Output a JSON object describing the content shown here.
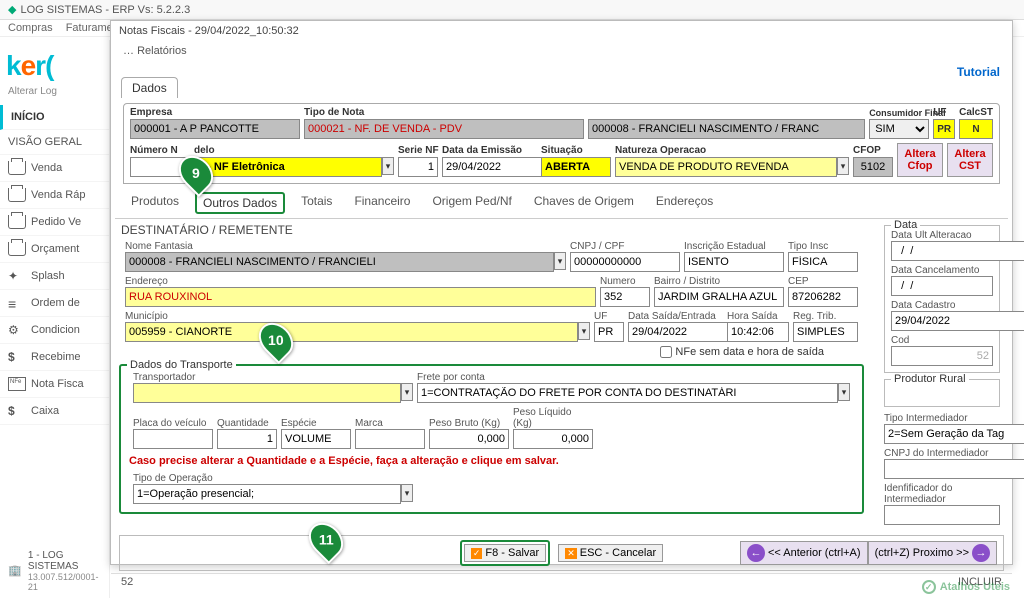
{
  "window": {
    "title": "LOG SISTEMAS - ERP Vs: 5.2.2.3"
  },
  "topmenu": {
    "compras": "Compras",
    "faturamento": "Faturamento"
  },
  "logo": {
    "k": "k",
    "e": "e",
    "r": "r",
    "alterar": "Alterar Log"
  },
  "nav": {
    "inicio": "INÍCIO",
    "visao": "VISÃO GERAL",
    "venda": "Venda",
    "vendarap": "Venda Ráp",
    "pedido": "Pedido Ve",
    "orcamento": "Orçament",
    "splash": "Splash",
    "ordem": "Ordem de",
    "condicio": "Condicion",
    "recebim": "Recebime",
    "notafis": "Nota Fisca",
    "caixa": "Caixa"
  },
  "dialog": {
    "title": "Notas Fiscais - 29/04/2022_10:50:32",
    "relatorios": "Relatórios",
    "tutorial": "Tutorial",
    "dados": "Dados"
  },
  "hdrf": {
    "empresa_lbl": "Empresa",
    "empresa_val": "000001 - A P PANCOTTE",
    "tiponota_lbl": "Tipo de Nota",
    "tiponota_val": "000021 - NF. DE VENDA - PDV",
    "cliente_val": "000008 - FRANCIELI NASCIMENTO / FRANC",
    "consfinal_lbl": "Consumidor Final",
    "consfinal_val": "SIM",
    "uf_lbl": "UF",
    "uf_val": "PR",
    "calcst_lbl": "CalcST",
    "calcst_val": "N",
    "numnf_lbl": "Número N",
    "modelo_lbl": "delo",
    "modelo_val": "5 - NF Eletrônica",
    "serie_lbl": "Serie NF",
    "serie_val": "1",
    "dataemi_lbl": "Data da Emissão",
    "dataemi_val": "29/04/2022",
    "situacao_lbl": "Situação",
    "situacao_val": "ABERTA",
    "natop_lbl": "Natureza Operacao",
    "natop_val": "VENDA DE PRODUTO REVENDA",
    "cfop_lbl": "CFOP",
    "cfop_val": "5102",
    "altera_cfop": "Altera Cfop",
    "altera_cst": "Altera CST"
  },
  "subtabs": {
    "produtos": "Produtos",
    "outros": "Outros Dados",
    "totais": "Totais",
    "financeiro": "Financeiro",
    "origem": "Origem Ped/Nf",
    "chaves": "Chaves de Origem",
    "enderecos": "Endereços"
  },
  "dest": {
    "title": "DESTINATÁRIO / REMETENTE",
    "nomefant_lbl": "Nome Fantasia",
    "nomefant_val": "000008 - FRANCIELI NASCIMENTO / FRANCIELI",
    "cnpj_lbl": "CNPJ / CPF",
    "cnpj_val": "00000000000",
    "insc_lbl": "Inscrição Estadual",
    "insc_val": "ISENTO",
    "tipoinsc_lbl": "Tipo Insc",
    "tipoinsc_val": "FÍSICA",
    "endereco_lbl": "Endereço",
    "endereco_val": "RUA ROUXINOL",
    "numero_lbl": "Numero",
    "numero_val": "352",
    "bairro_lbl": "Bairro / Distrito",
    "bairro_val": "JARDIM GRALHA AZUL",
    "cep_lbl": "CEP",
    "cep_val": "87206282",
    "municipio_lbl": "Município",
    "municipio_val": "005959 - CIANORTE",
    "uf_lbl": "UF",
    "uf_val": "PR",
    "datasaida_lbl": "Data Saída/Entrada",
    "datasaida_val": "29/04/2022",
    "horasaida_lbl": "Hora Saída",
    "horasaida_val": "10:42:06",
    "regtrib_lbl": "Reg. Trib.",
    "regtrib_val": "SIMPLES",
    "nfe_chk": "NFe sem data e hora de saída"
  },
  "datagroup": {
    "title": "Data",
    "ultalt_lbl": "Data Ult Alteracao",
    "ultalt_val": "  /  /",
    "cancel_lbl": "Data Cancelamento",
    "cancel_val": "  /  /",
    "cadastro_lbl": "Data Cadastro",
    "cadastro_val": "29/04/2022",
    "cod_lbl": "Cod",
    "cod_val": "52"
  },
  "transp": {
    "title": "Dados do Transporte",
    "transp_lbl": "Transportador",
    "frete_lbl": "Frete por conta",
    "frete_val": "1=CONTRATAÇÃO DO FRETE POR CONTA DO DESTINATÁRI",
    "placa_lbl": "Placa do veículo",
    "qtd_lbl": "Quantidade",
    "qtd_val": "1",
    "especie_lbl": "Espécie",
    "especie_val": "VOLUME",
    "marca_lbl": "Marca",
    "pesobruto_lbl": "Peso Bruto (Kg)",
    "pesobruto_val": "0,000",
    "pesoliq_lbl": "Peso Líquido (Kg)",
    "pesoliq_val": "0,000",
    "hint": "Caso precise alterar a Quantidade e a Espécie,  faça a alteração e  clique em salvar.",
    "tipoop_lbl": "Tipo de Operação",
    "tipoop_val": "1=Operação presencial;"
  },
  "prodrural": {
    "title": "Produtor Rural",
    "tipoint_lbl": "Tipo Intermediador",
    "tipoint_val": "2=Sem Geração da Tag",
    "cnpjint_lbl": "CNPJ do Intermediador",
    "idint_lbl": "Idenfificador do Intermediador"
  },
  "bottom": {
    "salvar": "F8 - Salvar",
    "cancelar": "ESC - Cancelar",
    "anterior": "<< Anterior (ctrl+A)",
    "proximo": "(ctrl+Z) Proximo >>"
  },
  "status": {
    "left": "52",
    "right": "INCLUIR"
  },
  "footer": {
    "org": "1 - LOG SISTEMAS",
    "cnpj": "13.007.512/0001-21",
    "atalhos": "Atalhos Uteis"
  },
  "pins": {
    "p9": "9",
    "p10": "10",
    "p11": "11"
  }
}
